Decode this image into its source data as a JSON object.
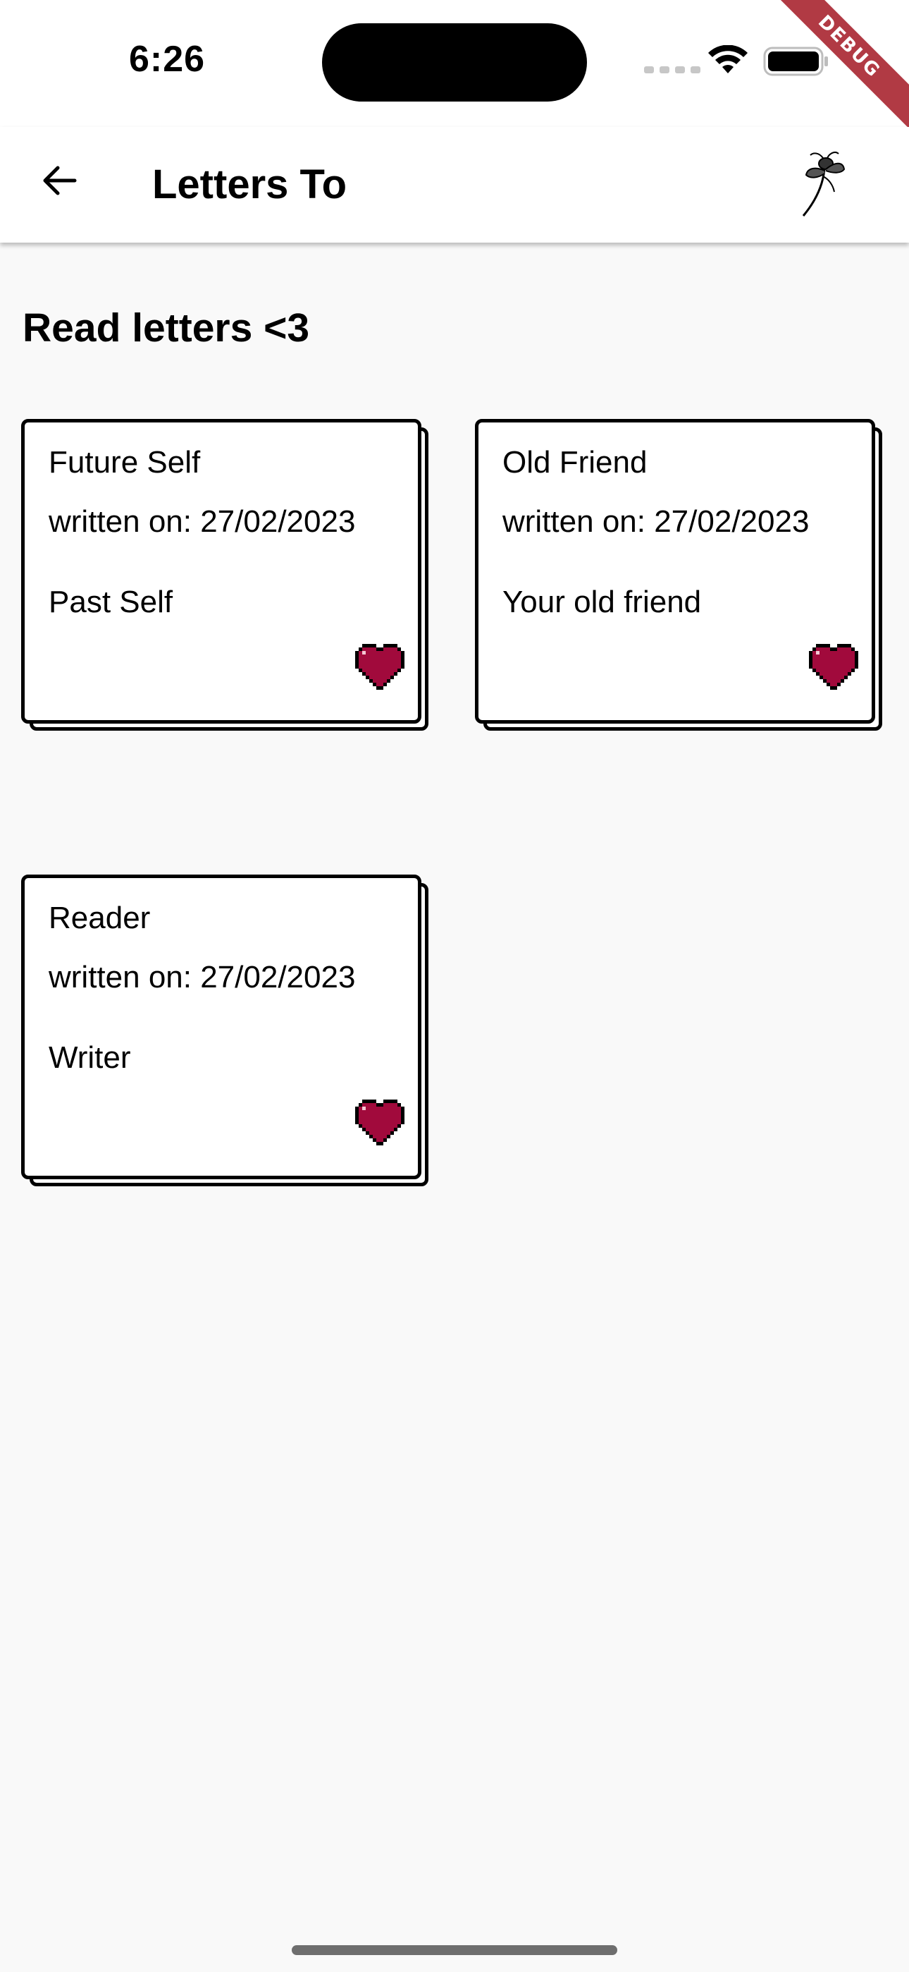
{
  "status_bar": {
    "time": "6:26",
    "debug_label": "DEBUG"
  },
  "app_bar": {
    "title": "Letters To"
  },
  "section": {
    "heading": "Read letters <3"
  },
  "letters": [
    {
      "recipient": "Future Self",
      "date": "written on: 27/02/2023",
      "sender": "Past Self"
    },
    {
      "recipient": "Old Friend",
      "date": "written on: 27/02/2023",
      "sender": "Your old friend"
    },
    {
      "recipient": "Reader",
      "date": "written on: 27/02/2023",
      "sender": "Writer"
    }
  ],
  "colors": {
    "heart": "#a10a3c",
    "heart_highlight": "#f4c7d4",
    "background": "#f9f9f9",
    "debug_banner": "#b13a44"
  },
  "icons": {
    "back": "arrow-left-icon",
    "logo": "dragonfly-icon",
    "heart": "pixel-heart-icon"
  }
}
